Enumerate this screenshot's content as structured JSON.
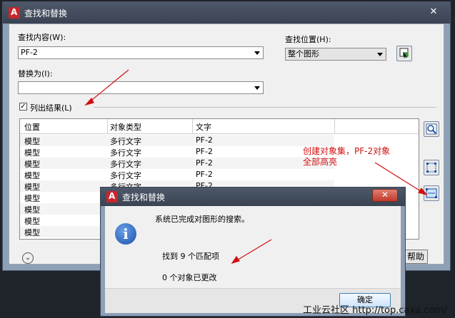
{
  "main_dialog": {
    "title": "查找和替换",
    "close": "✕",
    "find_label": "查找内容(W):",
    "find_value": "PF-2",
    "replace_label": "替换为(I):",
    "replace_value": "",
    "location_label": "查找位置(H):",
    "location_value": "整个图形",
    "list_results_label": "列出结果(L)",
    "list_results_checked": "✓",
    "table": {
      "headers": [
        "位置",
        "对象类型",
        "文字"
      ],
      "rows": [
        [
          "模型",
          "多行文字",
          "PF-2"
        ],
        [
          "模型",
          "多行文字",
          "PF-2"
        ],
        [
          "模型",
          "多行文字",
          "PF-2"
        ],
        [
          "模型",
          "多行文字",
          "PF-2"
        ],
        [
          "模型",
          "多行文字",
          "PF-2"
        ],
        [
          "模型",
          "",
          ""
        ],
        [
          "模型",
          "",
          ""
        ],
        [
          "模型",
          "",
          ""
        ],
        [
          "模型",
          "",
          ""
        ]
      ]
    },
    "help_button": "帮助",
    "expand_icon": "⌄"
  },
  "message_box": {
    "title": "查找和替换",
    "close": "✕",
    "message": "系统已完成对图形的搜索。",
    "found": "找到 9 个匹配项",
    "changed": "0 个对象已更改",
    "ok": "确定"
  },
  "annotation": {
    "line1": "创建对象集，PF-2对象",
    "line2": "全部高亮"
  },
  "watermark": "工业云社区 http://top.caxa.com/",
  "colors": {
    "annotation": "#d01010",
    "title_bar": "#3a4352",
    "app_logo": "#c8262b"
  }
}
